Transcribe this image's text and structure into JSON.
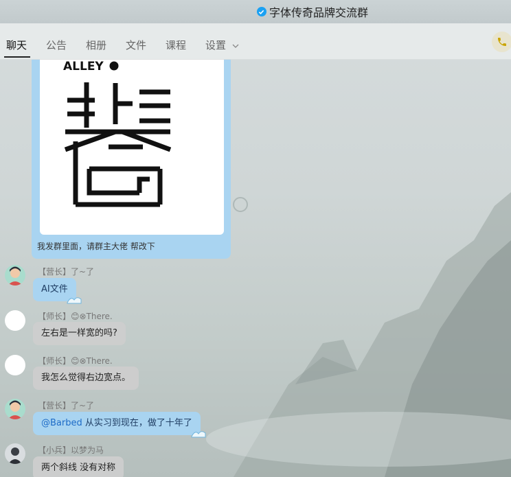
{
  "window": {
    "title": "字体传奇品牌交流群"
  },
  "tabs": [
    {
      "label": "聊天",
      "active": true
    },
    {
      "label": "公告"
    },
    {
      "label": "相册"
    },
    {
      "label": "文件"
    },
    {
      "label": "课程"
    },
    {
      "label": "设置"
    }
  ],
  "colors": {
    "accent": "#1aa1f3",
    "bubble_blue": "#a9d4f1",
    "bubble_grey": "#cdcdcd"
  },
  "image_message": {
    "image_text": "ALLEY",
    "caption": "我发群里面，请群主大佬 帮改下"
  },
  "messages": [
    {
      "sender": "【营长】了~了",
      "text": "AI文件",
      "style": "blue",
      "avatar": "cartoon-avatar"
    },
    {
      "sender": "【师长】😊⊗There.",
      "text": "左右是一样宽的吗?",
      "style": "grey",
      "avatar": "blank-avatar"
    },
    {
      "sender": "【师长】😊⊗There.",
      "text": "我怎么觉得右边宽点。",
      "style": "grey",
      "avatar": "blank-avatar"
    },
    {
      "sender": "【营长】了~了",
      "mention": "@Barbed",
      "text": " 从实习到现在，做了十年了",
      "style": "blue",
      "avatar": "cartoon-avatar"
    },
    {
      "sender": "【小兵】以梦为马",
      "text": "两个斜线 没有对称",
      "style": "grey",
      "avatar": "photo-avatar"
    }
  ]
}
